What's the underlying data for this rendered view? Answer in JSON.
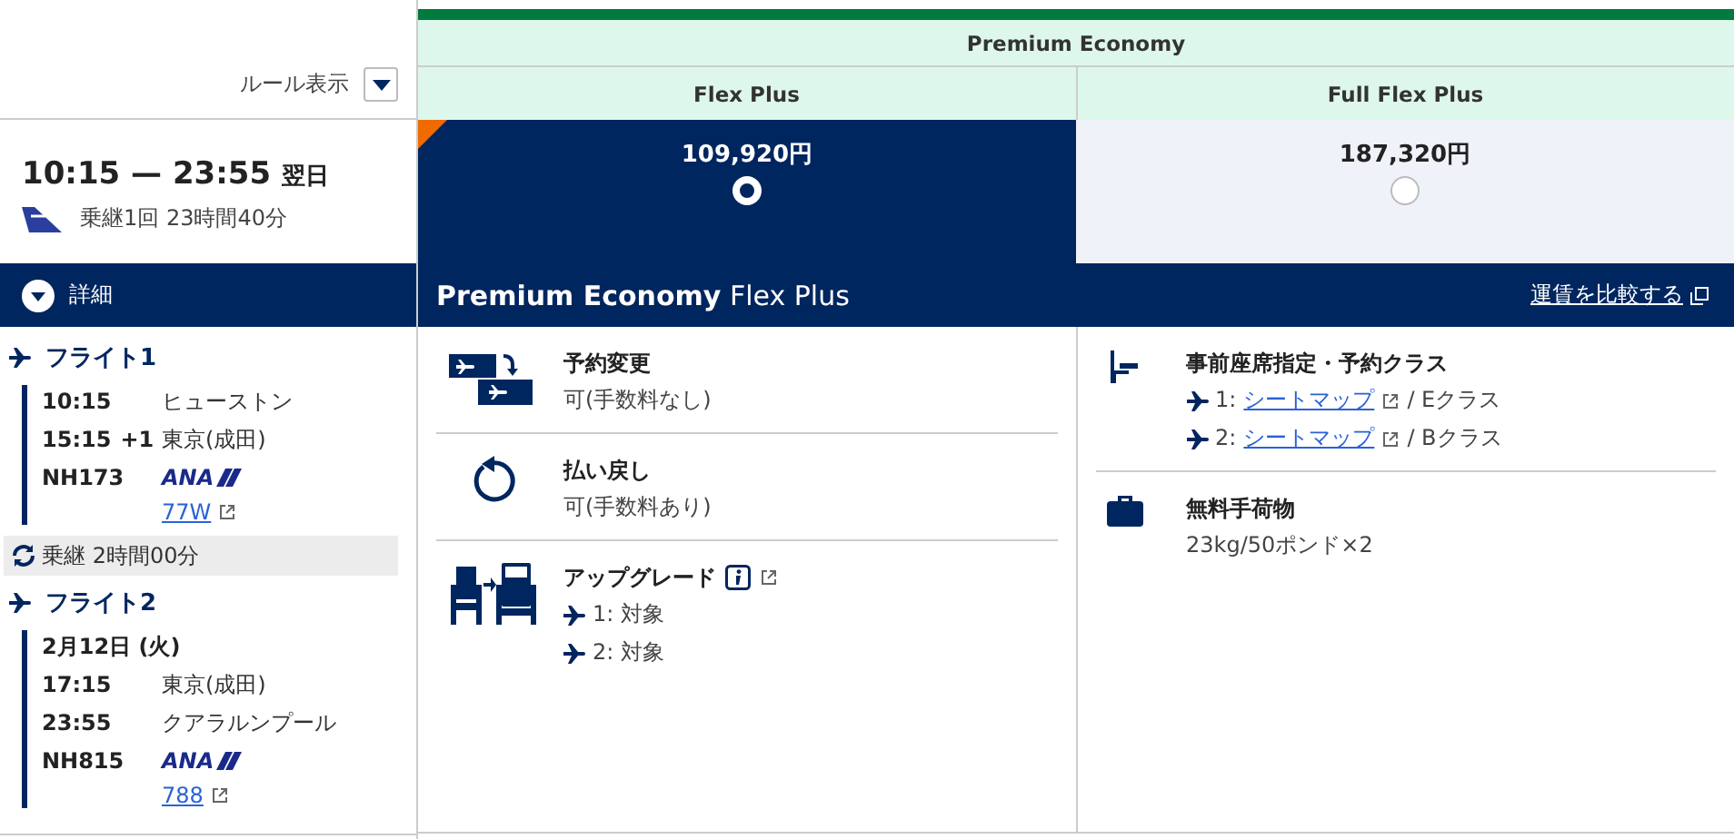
{
  "rules_toggle": {
    "label": "ルール表示"
  },
  "summary": {
    "times": "10:15 — 23:55",
    "next_day": "翌日",
    "info": "乗継1回 23時間40分"
  },
  "details_toggle": {
    "label": "詳細"
  },
  "itinerary": [
    {
      "kind": "flight",
      "title": "フライト1",
      "rows": [
        {
          "time": "10:15",
          "place": "ヒューストン"
        },
        {
          "time": "15:15",
          "day_offset": "+1",
          "place": "東京(成田)"
        }
      ],
      "number": "NH173",
      "airline": "ANA",
      "aircraft": "77W"
    },
    {
      "kind": "connection",
      "label": "乗継 2時間00分"
    },
    {
      "kind": "flight",
      "title": "フライト2",
      "date": "2月12日 (火)",
      "rows": [
        {
          "time": "17:15",
          "place": "東京(成田)"
        },
        {
          "time": "23:55",
          "place": "クアラルンプール"
        }
      ],
      "number": "NH815",
      "airline": "ANA",
      "aircraft": "788"
    }
  ],
  "cabin": "Premium Economy",
  "fares": [
    {
      "name": "Flex Plus",
      "price": "109,920円",
      "selected": true
    },
    {
      "name": "Full Flex Plus",
      "price": "187,320円",
      "selected": false
    }
  ],
  "detail": {
    "title": "Premium Economy",
    "subtitle": "Flex Plus",
    "compare_link": "運賃を比較する",
    "columns": [
      [
        {
          "kind": "change",
          "title": "予約変更",
          "value": "可(手数料なし)"
        },
        {
          "kind": "refund",
          "title": "払い戻し",
          "value": "可(手数料あり)"
        },
        {
          "kind": "upgrade",
          "title": "アップグレード",
          "info": true,
          "flights": [
            {
              "no": "1:",
              "text": "対象"
            },
            {
              "no": "2:",
              "text": "対象"
            }
          ]
        }
      ],
      [
        {
          "kind": "seat",
          "title": "事前座席指定・予約クラス",
          "flights": [
            {
              "no": "1:",
              "link": "シートマップ",
              "text": "/ Eクラス"
            },
            {
              "no": "2:",
              "link": "シートマップ",
              "text": "/ Bクラス"
            }
          ]
        },
        {
          "kind": "baggage",
          "title": "無料手荷物",
          "value": "23kg/50ポンド×2"
        }
      ]
    ]
  }
}
